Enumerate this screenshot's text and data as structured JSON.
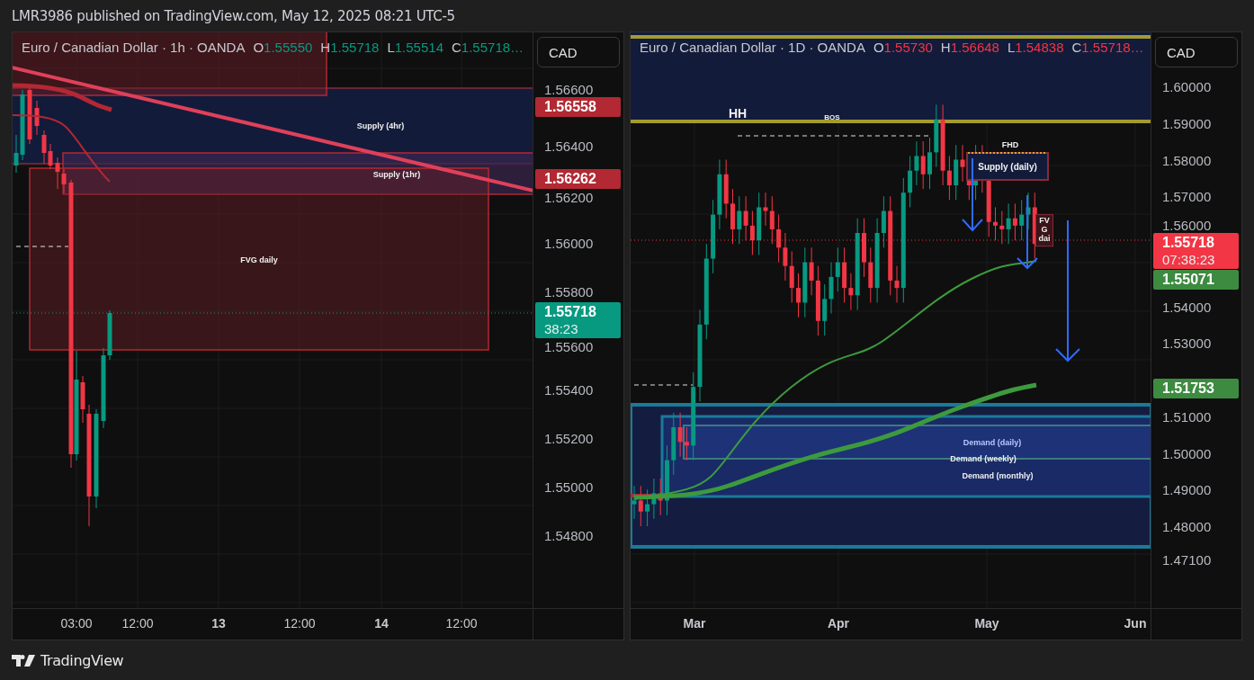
{
  "header": {
    "text": "LMR3986 published on TradingView.com, May 12, 2025 08:21 UTC-5"
  },
  "panels": [
    {
      "legend": {
        "title": "Euro / Canadian Dollar · 1h · OANDA",
        "bullish": true,
        "values": [
          {
            "key": "O",
            "value": "1.55550"
          },
          {
            "key": "H",
            "value": "1.55718"
          },
          {
            "key": "L",
            "value": "1.55514"
          },
          {
            "key": "C",
            "value": "1.55718…"
          }
        ]
      },
      "currency_button": "CAD",
      "price_ticks": [
        "1.56600",
        "1.56400",
        "1.56200",
        "1.56000",
        "1.55800",
        "1.55600",
        "1.55400",
        "1.55200",
        "1.55000",
        "1.54800"
      ],
      "price_labels": [
        {
          "value": "1.56558",
          "color": "#b22833"
        },
        {
          "value": "1.56262",
          "color": "#b22833"
        },
        {
          "value": "1.55718",
          "countdown": "38:23",
          "color": "#089981"
        }
      ],
      "annotations": [
        "Supply (4hr)",
        "Supply (1hr)",
        "FVG daily"
      ],
      "time_labels": [
        {
          "label": "03:00",
          "kind": "minor"
        },
        {
          "label": "12:00",
          "kind": "minor"
        },
        {
          "label": "13",
          "kind": "major"
        },
        {
          "label": "12:00",
          "kind": "minor"
        },
        {
          "label": "14",
          "kind": "major"
        },
        {
          "label": "12:00",
          "kind": "minor"
        }
      ]
    },
    {
      "legend": {
        "title": "Euro / Canadian Dollar · 1D · OANDA",
        "bullish": false,
        "values": [
          {
            "key": "O",
            "value": "1.55730"
          },
          {
            "key": "H",
            "value": "1.56648"
          },
          {
            "key": "L",
            "value": "1.54838"
          },
          {
            "key": "C",
            "value": "1.55718…"
          }
        ]
      },
      "currency_button": "CAD",
      "price_ticks": [
        "1.60000",
        "1.59000",
        "1.58000",
        "1.57000",
        "1.56000",
        "1.54000",
        "1.53000",
        "1.51000",
        "1.50000",
        "1.49000",
        "1.48000",
        "1.47100"
      ],
      "price_labels": [
        {
          "value": "1.55718",
          "countdown": "07:38:23",
          "color": "#f23645"
        },
        {
          "value": "1.55071",
          "color": "#3d8b40"
        },
        {
          "value": "1.51753",
          "color": "#3d8b40"
        }
      ],
      "annotations": [
        "HH",
        "BOS",
        "FHD",
        "Supply (daily)",
        "FVG dai",
        "Demand (daily)",
        "Demand (weekly)",
        "Demand (monthly)"
      ],
      "time_labels": [
        {
          "label": "Mar",
          "kind": "major"
        },
        {
          "label": "Apr",
          "kind": "major"
        },
        {
          "label": "May",
          "kind": "major"
        },
        {
          "label": "Jun",
          "kind": "major"
        }
      ]
    }
  ],
  "footer": {
    "brand": "TradingView"
  }
}
